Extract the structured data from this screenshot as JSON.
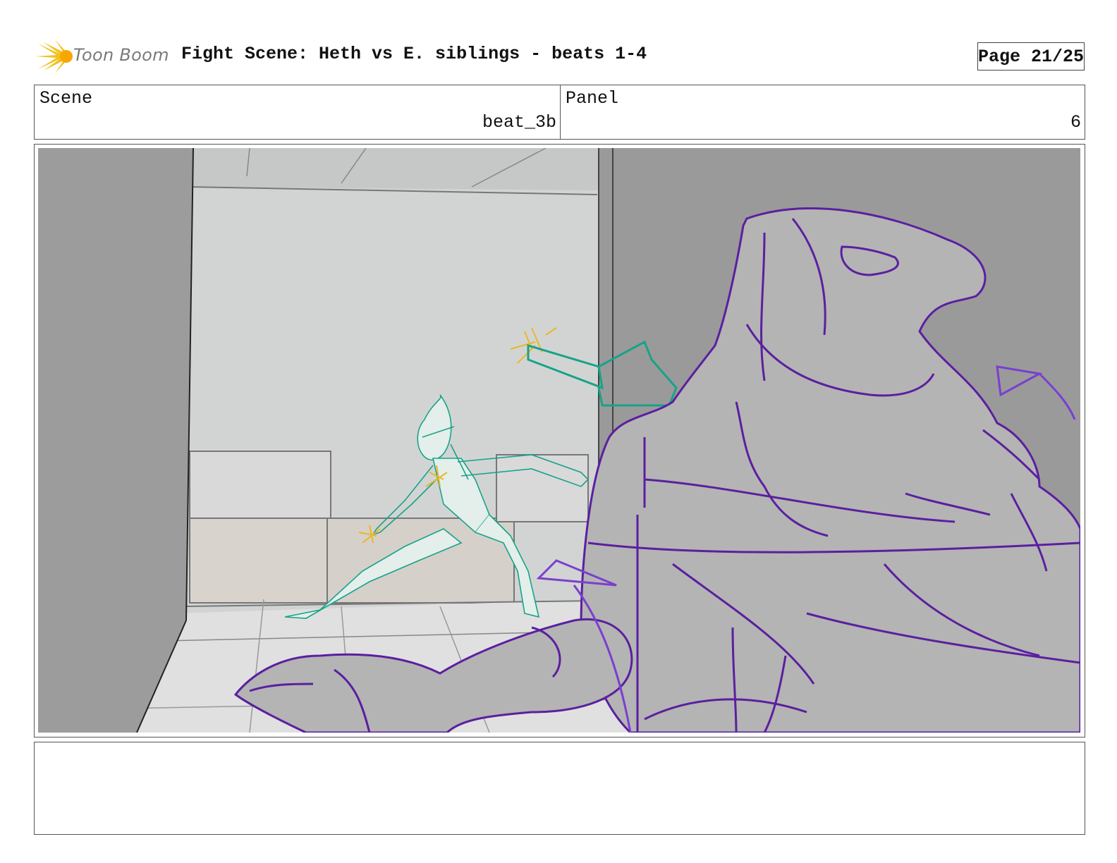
{
  "header": {
    "logo_text": "Toon Boom",
    "title": "Fight Scene: Heth vs E. siblings - beats 1-4",
    "page": "Page 21/25"
  },
  "info": {
    "scene_label": "Scene",
    "scene_value": "beat_3b",
    "panel_label": "Panel",
    "panel_value": "6"
  },
  "colors": {
    "foreground_character": "#5b1fa0",
    "background_character": "#17a388",
    "spark": "#eab72a",
    "wall": "#9a9a9a"
  },
  "notes": {
    "text": ""
  }
}
